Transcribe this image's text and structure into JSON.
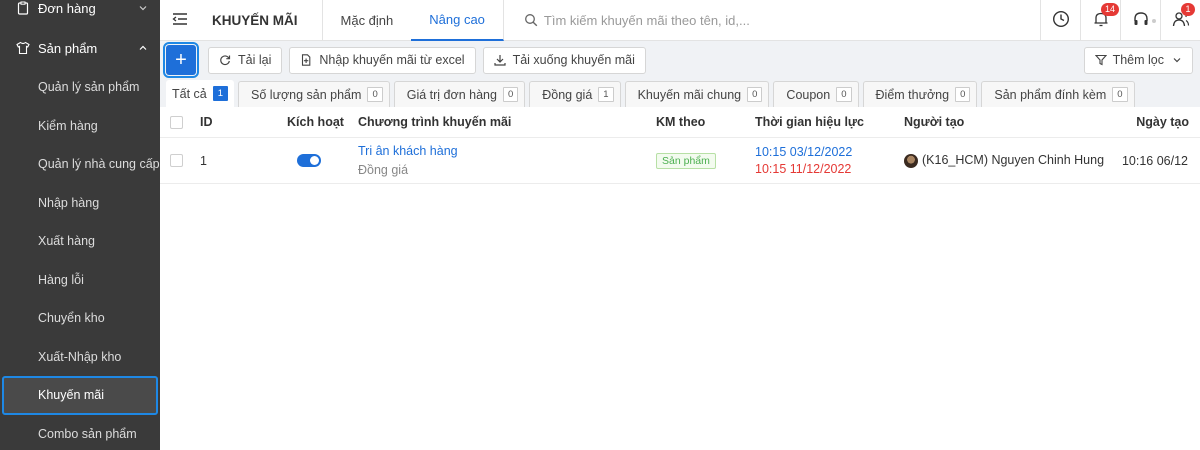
{
  "sidebar": {
    "group_orders": "Đơn hàng",
    "group_products": "Sản phẩm",
    "items": [
      {
        "label": "Quản lý sản phẩm"
      },
      {
        "label": "Kiểm hàng"
      },
      {
        "label": "Quản lý nhà cung cấp"
      },
      {
        "label": "Nhập hàng"
      },
      {
        "label": "Xuất hàng"
      },
      {
        "label": "Hàng lỗi"
      },
      {
        "label": "Chuyển kho"
      },
      {
        "label": "Xuất-Nhập kho"
      },
      {
        "label": "Khuyến mãi"
      },
      {
        "label": "Combo sản phẩm"
      }
    ]
  },
  "header": {
    "title": "KHUYẾN MÃI",
    "tabs": [
      {
        "label": "Mặc định"
      },
      {
        "label": "Nâng cao"
      }
    ],
    "search_placeholder": "Tìm kiếm khuyến mãi theo tên, id,...",
    "notifications_badge": "14",
    "users_badge": "1"
  },
  "actions": {
    "add": "+",
    "reload": "Tải lại",
    "import": "Nhập khuyến mãi từ excel",
    "download": "Tải xuống khuyến mãi",
    "filter": "Thêm lọc"
  },
  "filter_tabs": [
    {
      "label": "Tất cả",
      "count": "1"
    },
    {
      "label": "Số lượng sản phẩm",
      "count": "0"
    },
    {
      "label": "Giá trị đơn hàng",
      "count": "0"
    },
    {
      "label": "Đồng giá",
      "count": "1"
    },
    {
      "label": "Khuyến mãi chung",
      "count": "0"
    },
    {
      "label": "Coupon",
      "count": "0"
    },
    {
      "label": "Điểm thưởng",
      "count": "0"
    },
    {
      "label": "Sản phẩm đính kèm",
      "count": "0"
    }
  ],
  "table": {
    "headers": {
      "id": "ID",
      "active": "Kích hoạt",
      "program": "Chương trình khuyến mãi",
      "km_by": "KM theo",
      "period": "Thời gian hiệu lực",
      "creator": "Người tạo",
      "created": "Ngày tạo"
    },
    "rows": [
      {
        "id": "1",
        "active": true,
        "program_name": "Tri ân khách hàng",
        "program_type": "Đồng giá",
        "km_by": "Sản phẩm",
        "start": "10:15 03/12/2022",
        "end": "10:15 11/12/2022",
        "creator": "(K16_HCM) Nguyen Chinh Hung",
        "created": "10:16 06/12"
      }
    ]
  },
  "colors": {
    "accent": "#1e6fd9",
    "sidebar_bg": "#3a3a3a",
    "danger": "#e53935",
    "success": "#4caf50"
  }
}
